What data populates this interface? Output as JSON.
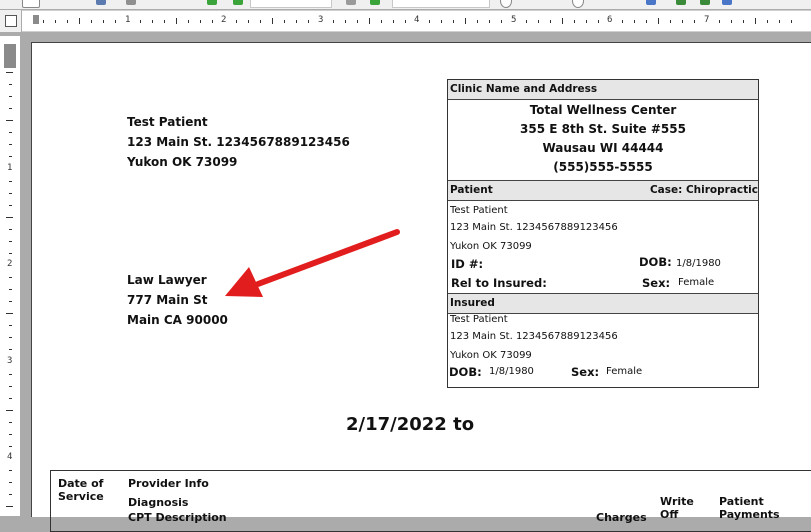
{
  "ruler": {
    "horizontal_numbers": [
      "1",
      "2",
      "3",
      "4",
      "5",
      "6",
      "7"
    ],
    "vertical_numbers": [
      "1",
      "2",
      "3",
      "4"
    ]
  },
  "patient_address": {
    "name": "Test Patient",
    "street": "123 Main St. 1234567889123456",
    "city_state_zip": "Yukon OK 73099"
  },
  "recipient_address": {
    "name": "Law Lawyer",
    "street": "777 Main St",
    "city_state_zip": "Main CA 90000"
  },
  "clinic_section": {
    "header": "Clinic Name and Address",
    "name": "Total Wellness Center",
    "street": "355 E 8th St. Suite #555",
    "city_state_zip": "Wausau WI 44444",
    "phone": "(555)555-5555"
  },
  "patient_section": {
    "header": "Patient",
    "case_label": "Case: Chiropractic",
    "name": "Test Patient",
    "street": "123 Main St. 1234567889123456",
    "city_state_zip": "Yukon OK 73099",
    "id_label": "ID #:",
    "dob_label": "DOB:",
    "dob_value": "1/8/1980",
    "rel_label": "Rel to Insured:",
    "sex_label": "Sex:",
    "sex_value": "Female"
  },
  "insured_section": {
    "header": "Insured",
    "name": "Test Patient",
    "street": "123 Main St. 1234567889123456",
    "city_state_zip": "Yukon OK 73099",
    "dob_label": "DOB:",
    "dob_value": "1/8/1980",
    "sex_label": "Sex:",
    "sex_value": "Female"
  },
  "statement_period": "2/17/2022 to",
  "table_headers": {
    "date_of_service_line1": "Date of",
    "date_of_service_line2": "Service",
    "provider_info": "Provider Info",
    "diagnosis": "Diagnosis",
    "cpt_description": "CPT Description",
    "charges": "Charges",
    "write_off_line1": "Write",
    "write_off_line2": "Off",
    "patient_payments_line1": "Patient",
    "patient_payments_line2": "Payments"
  },
  "colors": {
    "annotation_arrow": "#e21d1d",
    "section_header_bg": "#e6e6e6"
  }
}
